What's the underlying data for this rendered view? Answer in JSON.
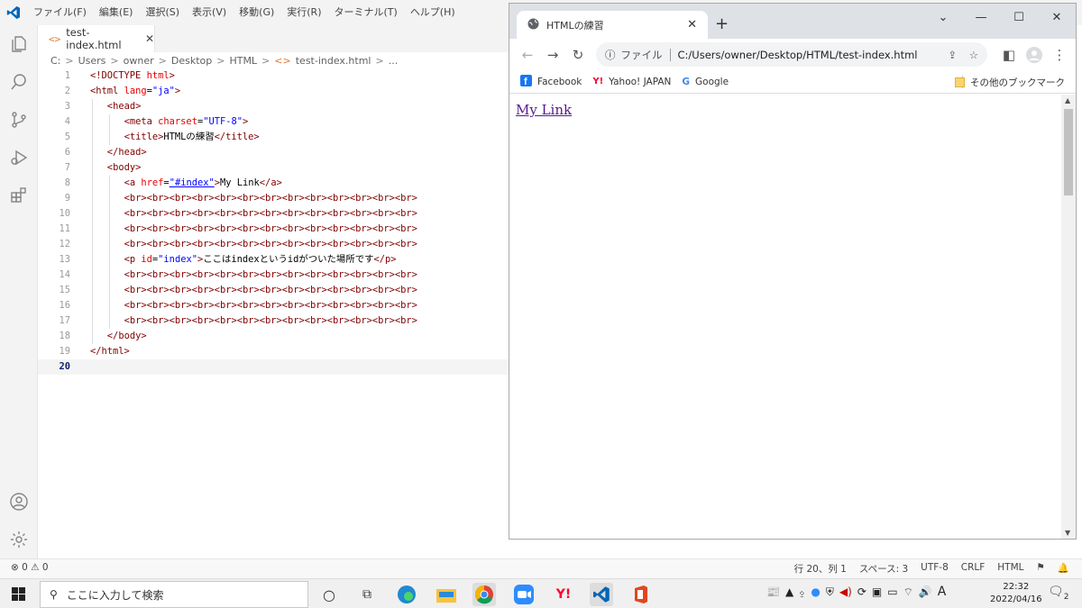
{
  "menubar": {
    "items": [
      "ファイル(F)",
      "編集(E)",
      "選択(S)",
      "表示(V)",
      "移動(G)",
      "実行(R)",
      "ターミナル(T)",
      "ヘルプ(H)"
    ]
  },
  "editor_tab": {
    "icon_text": "<>",
    "label": "test-index.html"
  },
  "breadcrumb": [
    "C:",
    "Users",
    "owner",
    "Desktop",
    "HTML",
    "test-index.html",
    "..."
  ],
  "code": {
    "lines": [
      {
        "n": "1",
        "indent": 0,
        "parts": [
          [
            "pun",
            "<!"
          ],
          [
            "tag",
            "DOCTYPE"
          ],
          [
            "txt",
            " "
          ],
          [
            "attr",
            "html"
          ],
          [
            "pun",
            ">"
          ]
        ]
      },
      {
        "n": "2",
        "indent": 0,
        "parts": [
          [
            "pun",
            "<"
          ],
          [
            "tag",
            "html"
          ],
          [
            "txt",
            " "
          ],
          [
            "attr",
            "lang"
          ],
          [
            "txt",
            "="
          ],
          [
            "val",
            "\"ja\""
          ],
          [
            "pun",
            ">"
          ]
        ]
      },
      {
        "n": "3",
        "indent": 1,
        "parts": [
          [
            "pun",
            "<"
          ],
          [
            "tag",
            "head"
          ],
          [
            "pun",
            ">"
          ]
        ]
      },
      {
        "n": "4",
        "indent": 2,
        "parts": [
          [
            "pun",
            "<"
          ],
          [
            "tag",
            "meta"
          ],
          [
            "txt",
            " "
          ],
          [
            "attr",
            "charset"
          ],
          [
            "txt",
            "="
          ],
          [
            "val",
            "\"UTF-8\""
          ],
          [
            "pun",
            ">"
          ]
        ]
      },
      {
        "n": "5",
        "indent": 2,
        "parts": [
          [
            "pun",
            "<"
          ],
          [
            "tag",
            "title"
          ],
          [
            "pun",
            ">"
          ],
          [
            "txt",
            "HTMLの練習"
          ],
          [
            "pun",
            "</"
          ],
          [
            "tag",
            "title"
          ],
          [
            "pun",
            ">"
          ]
        ]
      },
      {
        "n": "6",
        "indent": 1,
        "parts": [
          [
            "pun",
            "</"
          ],
          [
            "tag",
            "head"
          ],
          [
            "pun",
            ">"
          ]
        ]
      },
      {
        "n": "7",
        "indent": 1,
        "parts": [
          [
            "pun",
            "<"
          ],
          [
            "tag",
            "body"
          ],
          [
            "pun",
            ">"
          ]
        ]
      },
      {
        "n": "8",
        "indent": 2,
        "parts": [
          [
            "pun",
            "<"
          ],
          [
            "tag",
            "a"
          ],
          [
            "txt",
            " "
          ],
          [
            "attr",
            "href"
          ],
          [
            "txt",
            "="
          ],
          [
            "val",
            "\"#index\""
          ],
          [
            "pun",
            ">"
          ],
          [
            "txt",
            "My Link"
          ],
          [
            "pun",
            "</"
          ],
          [
            "tag",
            "a"
          ],
          [
            "pun",
            ">"
          ]
        ]
      },
      {
        "n": "9",
        "indent": 2,
        "parts": [
          [
            "tag",
            "<br><br><br><br><br><br><br><br><br><br><br><br><br>"
          ]
        ]
      },
      {
        "n": "10",
        "indent": 2,
        "parts": [
          [
            "tag",
            "<br><br><br><br><br><br><br><br><br><br><br><br><br>"
          ]
        ]
      },
      {
        "n": "11",
        "indent": 2,
        "parts": [
          [
            "tag",
            "<br><br><br><br><br><br><br><br><br><br><br><br><br>"
          ]
        ]
      },
      {
        "n": "12",
        "indent": 2,
        "parts": [
          [
            "tag",
            "<br><br><br><br><br><br><br><br><br><br><br><br><br>"
          ]
        ]
      },
      {
        "n": "13",
        "indent": 2,
        "parts": [
          [
            "pun",
            "<"
          ],
          [
            "tag",
            "p"
          ],
          [
            "txt",
            " "
          ],
          [
            "attr",
            "id"
          ],
          [
            "txt",
            "="
          ],
          [
            "val",
            "\"index\""
          ],
          [
            "pun",
            ">"
          ],
          [
            "txt",
            "ここはindexというidがついた場所です"
          ],
          [
            "pun",
            "</"
          ],
          [
            "tag",
            "p"
          ],
          [
            "pun",
            ">"
          ]
        ]
      },
      {
        "n": "14",
        "indent": 2,
        "parts": [
          [
            "tag",
            "<br><br><br><br><br><br><br><br><br><br><br><br><br>"
          ]
        ]
      },
      {
        "n": "15",
        "indent": 2,
        "parts": [
          [
            "tag",
            "<br><br><br><br><br><br><br><br><br><br><br><br><br>"
          ]
        ]
      },
      {
        "n": "16",
        "indent": 2,
        "parts": [
          [
            "tag",
            "<br><br><br><br><br><br><br><br><br><br><br><br><br>"
          ]
        ]
      },
      {
        "n": "17",
        "indent": 2,
        "parts": [
          [
            "tag",
            "<br><br><br><br><br><br><br><br><br><br><br><br><br>"
          ]
        ]
      },
      {
        "n": "18",
        "indent": 1,
        "parts": [
          [
            "pun",
            "</"
          ],
          [
            "tag",
            "body"
          ],
          [
            "pun",
            ">"
          ]
        ]
      },
      {
        "n": "19",
        "indent": 0,
        "parts": [
          [
            "pun",
            "</"
          ],
          [
            "tag",
            "html"
          ],
          [
            "pun",
            ">"
          ]
        ]
      },
      {
        "n": "20",
        "indent": 0,
        "parts": []
      }
    ],
    "current_line": "20"
  },
  "statusbar": {
    "problems": "⊗ 0 ⚠ 0",
    "position": "行 20、列 1",
    "indent": "スペース: 3",
    "encoding": "UTF-8",
    "eol": "CRLF",
    "language": "HTML"
  },
  "chrome": {
    "tab_title": "HTMLの練習",
    "scheme_label": "ファイル",
    "url": "C:/Users/owner/Desktop/HTML/test-index.html",
    "bookmarks": [
      "Facebook",
      "Yahoo! JAPAN",
      "Google"
    ],
    "other_bookmarks": "その他のブックマーク",
    "page_link": "My Link"
  },
  "taskbar": {
    "search_placeholder": "ここに入力して検索",
    "time": "22:32",
    "date": "2022/04/16",
    "ime": "A",
    "notification_count": "2"
  },
  "colors": {
    "vscode_blue": "#0066b8",
    "link_visited": "#551a8b",
    "chrome_frame": "#dee1e6"
  }
}
